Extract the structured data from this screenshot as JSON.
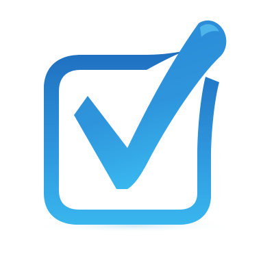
{
  "icon": {
    "name": "checkbox-checkmark-icon",
    "colors": {
      "blue_dark": "#1f6fbf",
      "blue_mid": "#2e95dc",
      "blue_light": "#39b6ee",
      "background": "#ffffff"
    }
  }
}
